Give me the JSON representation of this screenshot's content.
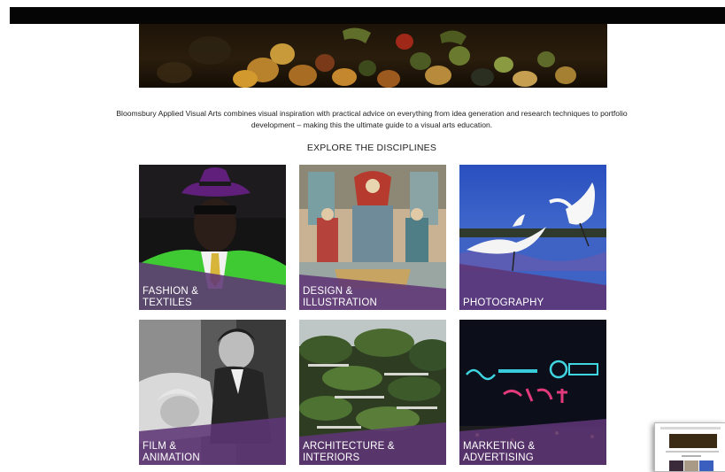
{
  "intro": {
    "line1": "Bloomsbury Applied Visual Arts combines visual inspiration with practical advice on everything from idea generation and research techniques to portfolio",
    "line2": "development – making this the ultimate guide to a visual arts education."
  },
  "section_heading": "EXPLORE THE DISCIPLINES",
  "disciplines": [
    {
      "line1": "FASHION &",
      "line2": "TEXTILES"
    },
    {
      "line1": "DESIGN &",
      "line2": "ILLUSTRATION"
    },
    {
      "line1": "PHOTOGRAPHY",
      "line2": ""
    },
    {
      "line1": "FILM &",
      "line2": "ANIMATION"
    },
    {
      "line1": "ARCHITECTURE &",
      "line2": "INTERIORS"
    },
    {
      "line1": "MARKETING &",
      "line2": "ADVERTISING"
    }
  ],
  "colors": {
    "band_purple": "#5e3575",
    "top_bar": "#050505"
  }
}
